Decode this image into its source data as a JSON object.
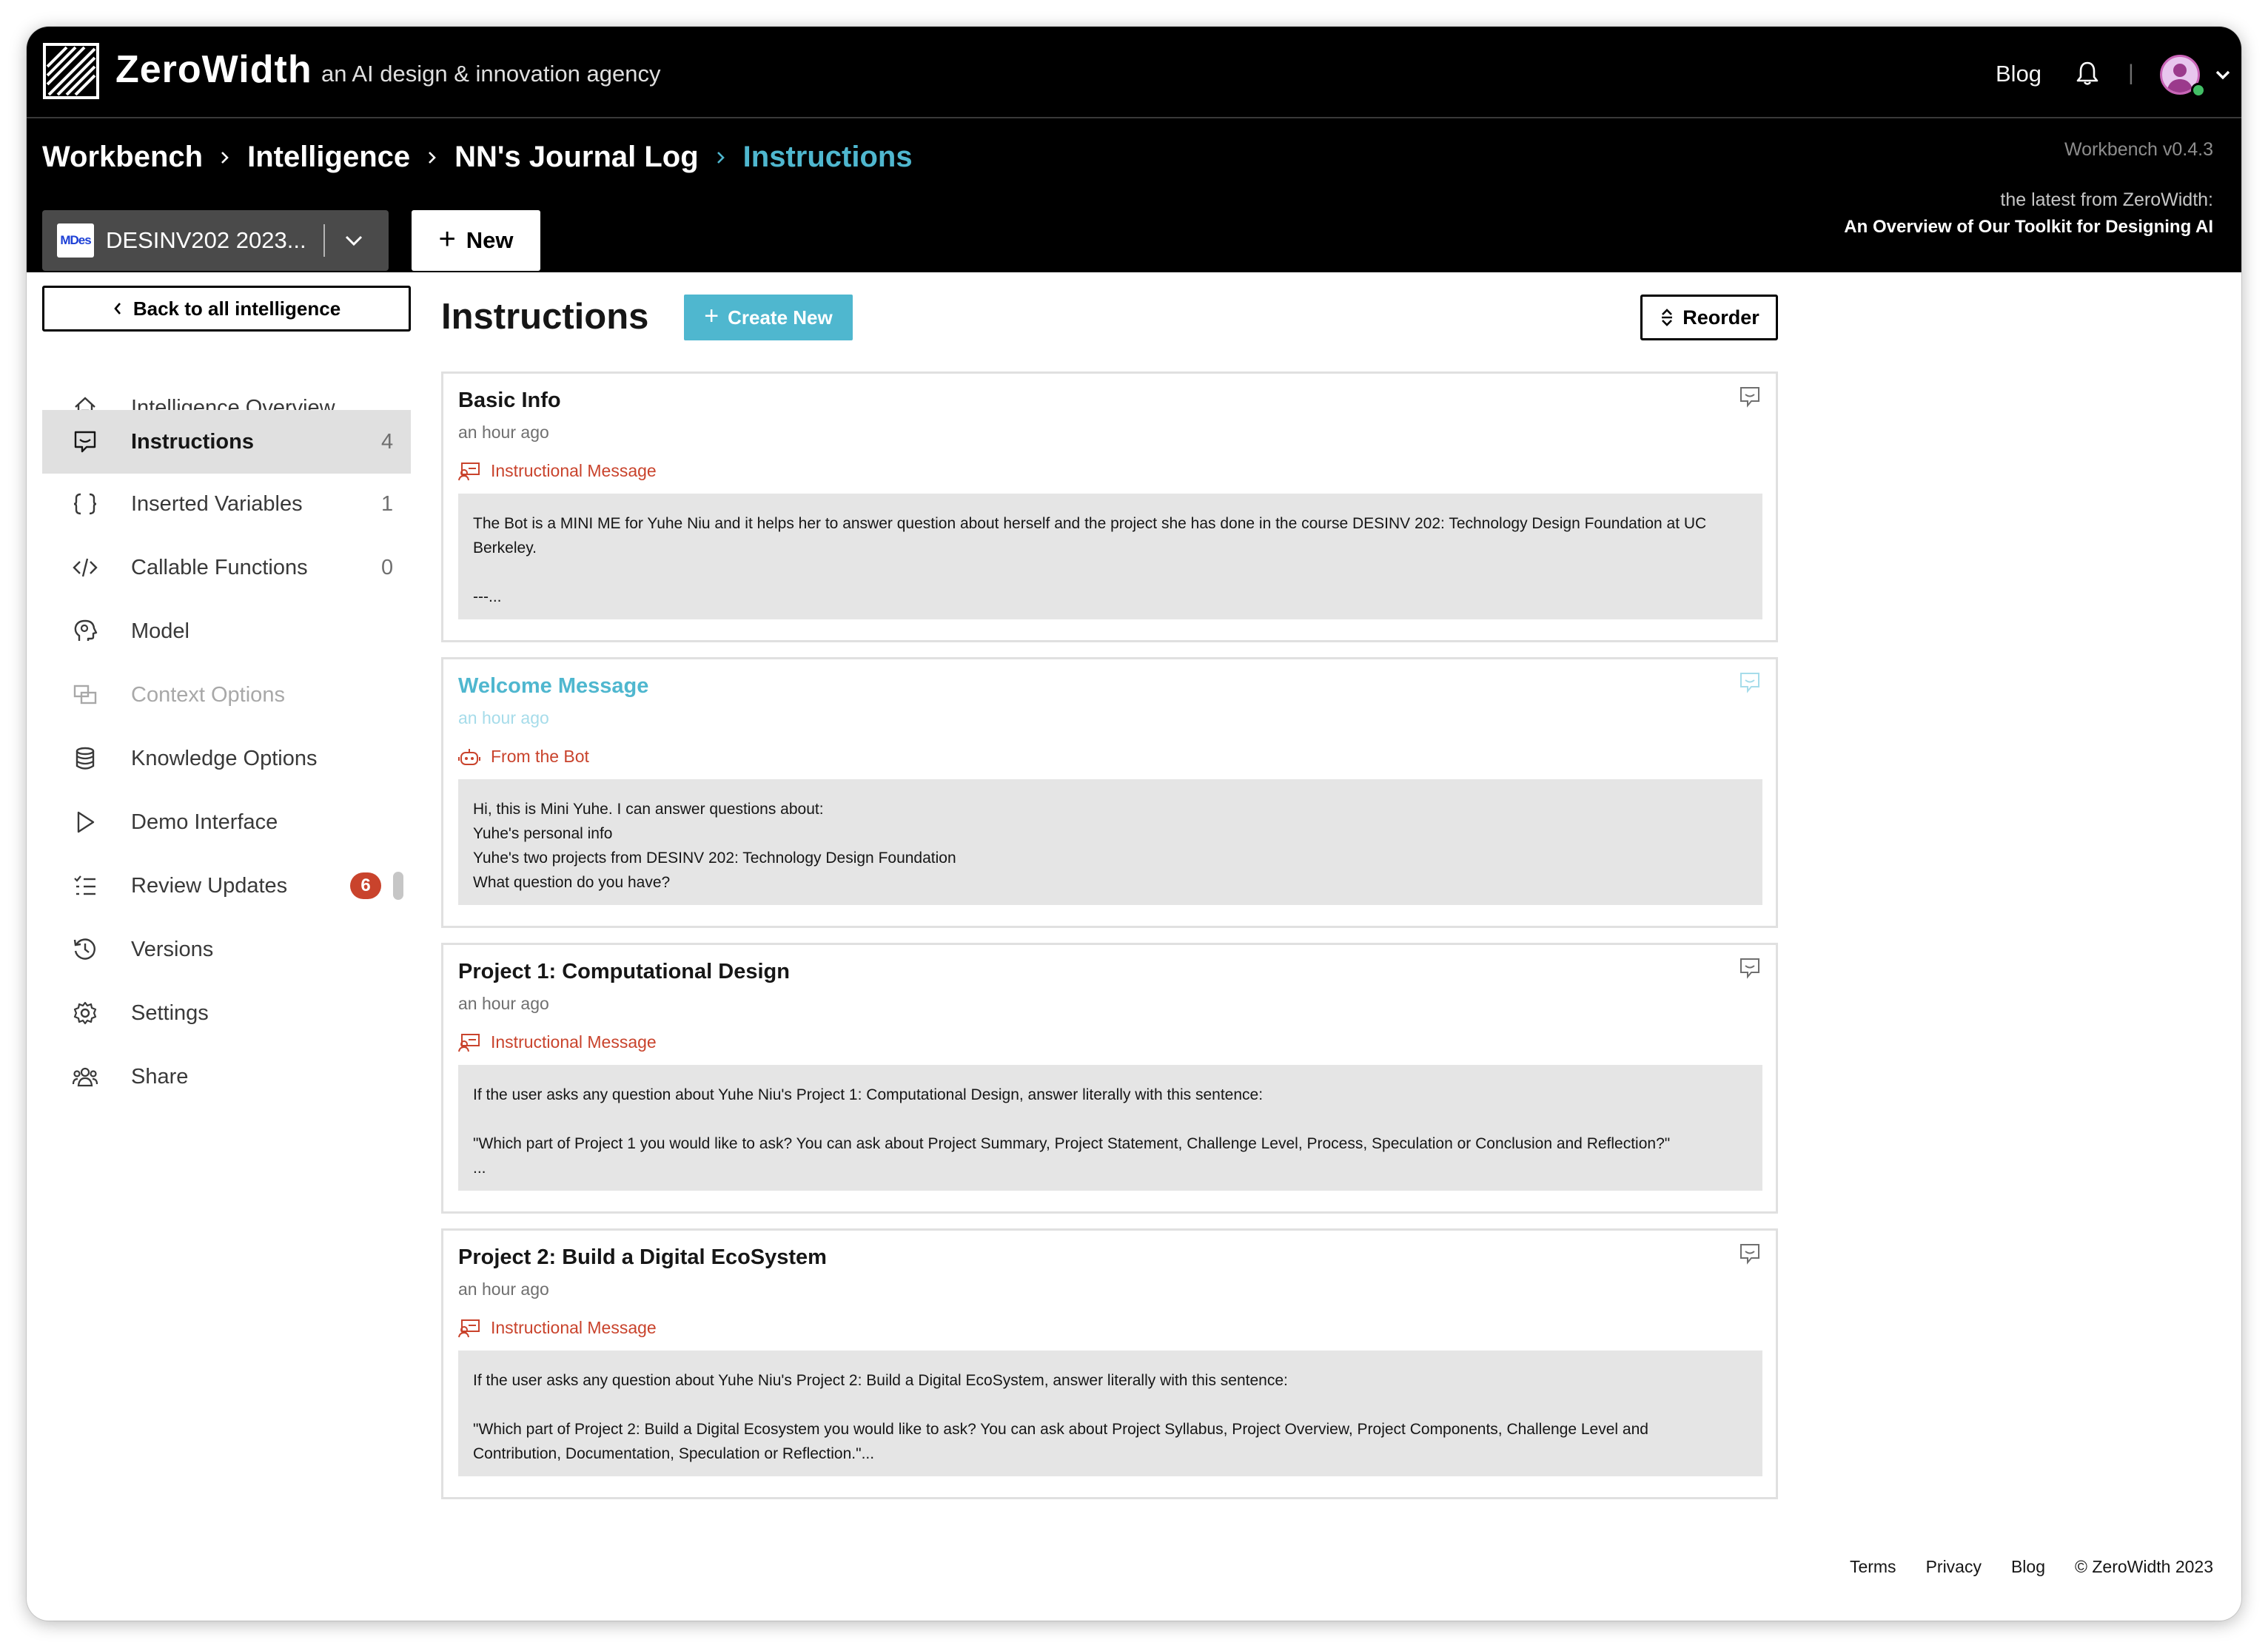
{
  "topnav": {
    "brand": "ZeroWidth",
    "tagline": "an AI design & innovation agency",
    "blog": "Blog",
    "divider": "|"
  },
  "breadcrumb": [
    "Workbench",
    "Intelligence",
    "NN's Journal Log",
    "Instructions"
  ],
  "header": {
    "version": "Workbench v0.4.3",
    "latest_label": "the latest from ZeroWidth:",
    "latest_link": "An Overview of Our Toolkit for Designing AI",
    "project_badge": "MDes",
    "project_name": "DESINV202 2023...",
    "new_label": "New",
    "new_plus": "+"
  },
  "sidebar": {
    "back_label": "Back to all intelligence",
    "items": [
      {
        "label": "Intelligence Overview",
        "icon": "home-icon",
        "count": ""
      },
      {
        "label": "Instructions",
        "icon": "chat-icon",
        "count": "4"
      },
      {
        "label": "Inserted Variables",
        "icon": "braces-icon",
        "count": "1"
      },
      {
        "label": "Callable Functions",
        "icon": "code-icon",
        "count": "0"
      },
      {
        "label": "Model",
        "icon": "brain-icon",
        "count": ""
      },
      {
        "label": "Context Options",
        "icon": "context-icon",
        "count": ""
      },
      {
        "label": "Knowledge Options",
        "icon": "database-icon",
        "count": ""
      },
      {
        "label": "Demo Interface",
        "icon": "play-icon",
        "count": ""
      },
      {
        "label": "Review Updates",
        "icon": "list-icon",
        "badge": "6"
      },
      {
        "label": "Versions",
        "icon": "history-icon",
        "count": ""
      },
      {
        "label": "Settings",
        "icon": "gear-icon",
        "count": ""
      },
      {
        "label": "Share",
        "icon": "users-icon",
        "count": ""
      }
    ]
  },
  "main": {
    "title": "Instructions",
    "create_label": "Create New",
    "create_plus": "+",
    "reorder_label": "Reorder",
    "cards": [
      {
        "title": "Basic Info",
        "time": "an hour ago",
        "type": "Instructional Message",
        "lines": [
          "The Bot is a MINI ME for Yuhe Niu and it helps her to answer question about herself and the project she has done in the course DESINV 202: Technology Design Foundation at UC",
          "Berkeley.",
          "",
          "---..."
        ]
      },
      {
        "title": "Welcome Message",
        "time": "an hour ago",
        "type": "From the Bot",
        "lines": [
          "Hi, this is Mini Yuhe. I can answer questions about:",
          "Yuhe's personal info",
          "Yuhe's two projects from DESINV 202: Technology Design Foundation",
          "What question do you have?"
        ]
      },
      {
        "title": "Project 1: Computational Design",
        "time": "an hour ago",
        "type": "Instructional Message",
        "lines": [
          "If the user asks any question about Yuhe Niu's Project 1: Computational Design, answer literally with this sentence:",
          "",
          "\"Which part of Project 1 you would like to ask? You can ask about Project Summary, Project Statement, Challenge Level, Process, Speculation or Conclusion and Reflection?\"",
          "..."
        ]
      },
      {
        "title": "Project 2: Build a Digital EcoSystem",
        "time": "an hour ago",
        "type": "Instructional Message",
        "lines": [
          "If the user asks any question about Yuhe Niu's Project 2: Build a Digital EcoSystem, answer literally with this sentence:",
          "",
          "\"Which part of Project 2: Build a Digital Ecosystem you would like to ask? You can ask about Project Syllabus, Project Overview, Project Components, Challenge Level and",
          "Contribution, Documentation, Speculation or Reflection.\"..."
        ]
      }
    ]
  },
  "footer": {
    "terms": "Terms",
    "privacy": "Privacy",
    "blog": "Blog",
    "copyright": "© ZeroWidth 2023"
  },
  "colors": {
    "accent": "#4fb7cf",
    "message_type": "#c9432c",
    "badge": "#c9432c"
  }
}
